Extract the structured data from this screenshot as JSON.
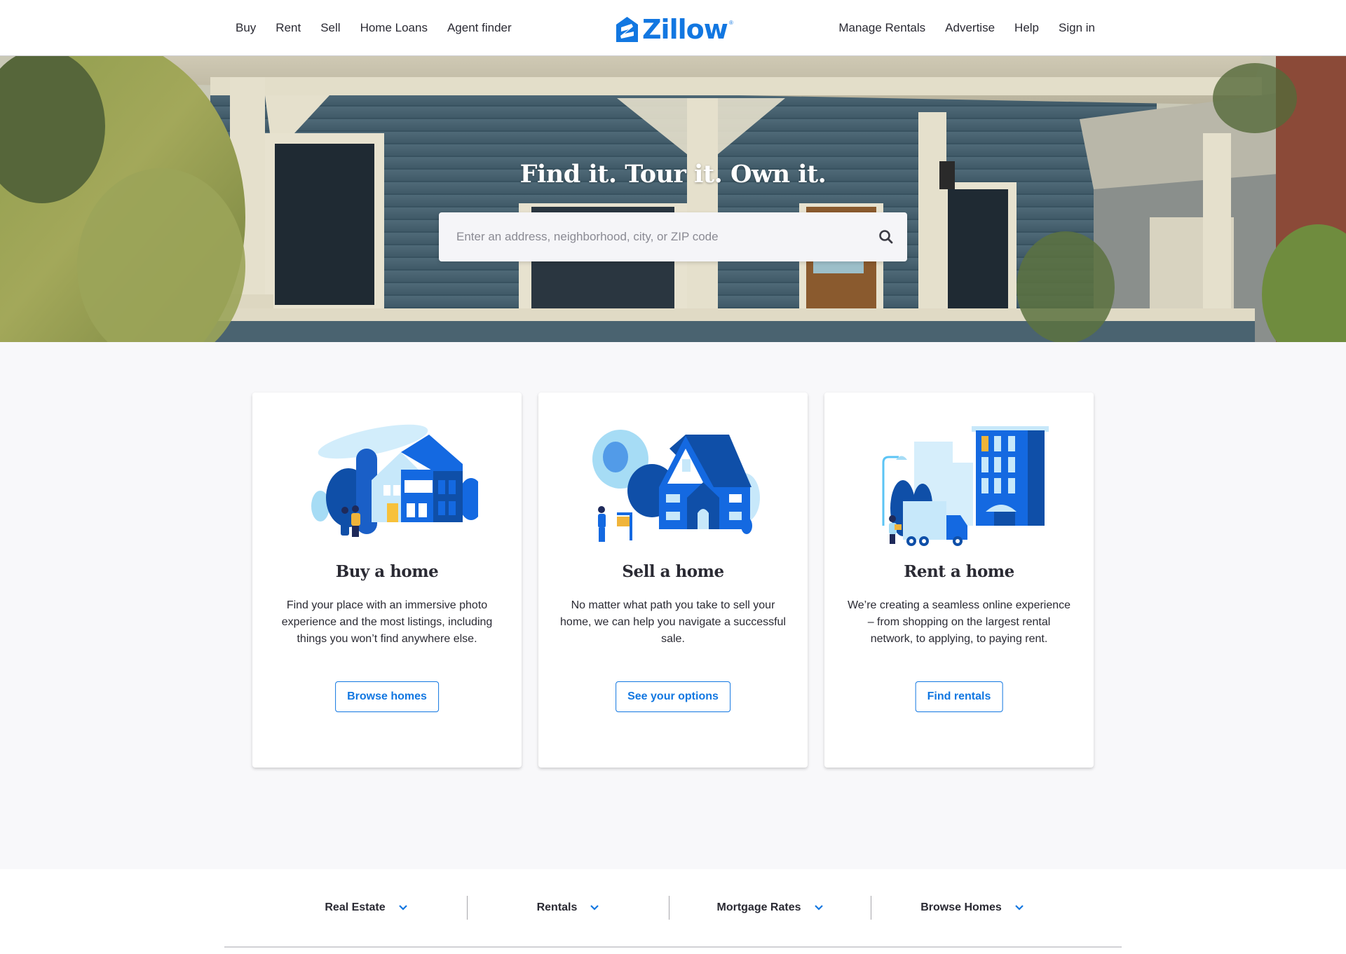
{
  "header": {
    "nav_left": [
      "Buy",
      "Rent",
      "Sell",
      "Home Loans",
      "Agent finder"
    ],
    "nav_right": [
      "Manage Rentals",
      "Advertise",
      "Help",
      "Sign in"
    ],
    "logo_text": "Zillow",
    "logo_reg": "®",
    "brand_color": "#1277e1"
  },
  "hero": {
    "title": "Find it. Tour it. Own it.",
    "search": {
      "placeholder": "Enter an address, neighborhood, city, or ZIP code",
      "value": "",
      "icon": "search-icon"
    }
  },
  "cards": [
    {
      "title": "Buy a home",
      "description": "Find your place with an immersive photo experience and the most listings, including things you won’t find anywhere else.",
      "button": "Browse homes",
      "illustration": "house-buyers-illustration"
    },
    {
      "title": "Sell a home",
      "description": "No matter what path you take to sell your home, we can help you navigate a successful sale.",
      "button": "See your options",
      "illustration": "house-for-sale-illustration"
    },
    {
      "title": "Rent a home",
      "description": "We’re creating a seamless online experience – from shopping on the largest rental network, to applying, to paying rent.",
      "button": "Find rentals",
      "illustration": "apartment-moving-truck-illustration"
    }
  ],
  "footer": {
    "nav": [
      "Real Estate",
      "Rentals",
      "Mortgage Rates",
      "Browse Homes"
    ],
    "chevron_icon": "chevron-down-icon"
  }
}
